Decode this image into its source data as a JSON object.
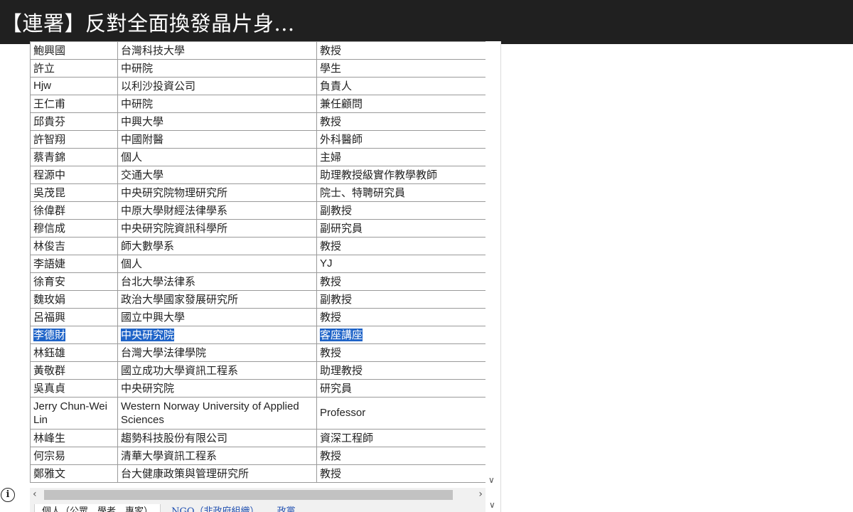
{
  "header": {
    "title": "【連署】反對全面換發晶片身..."
  },
  "table": {
    "rows": [
      {
        "name": "鮑興國",
        "org": "台灣科技大學",
        "title": "教授"
      },
      {
        "name": "許立",
        "org": "中研院",
        "title": "學生"
      },
      {
        "name": "Hjw",
        "org": "以利沙投資公司",
        "title": "負責人"
      },
      {
        "name": "王仁甫",
        "org": "中研院",
        "title": "兼任顧問"
      },
      {
        "name": "邱貴芬",
        "org": "中興大學",
        "title": "教授"
      },
      {
        "name": "許智翔",
        "org": "中國附醫",
        "title": "外科醫師"
      },
      {
        "name": "蔡青錦",
        "org": "個人",
        "title": "主婦"
      },
      {
        "name": "程源中",
        "org": "交通大學",
        "title": "助理教授級實作教學教師"
      },
      {
        "name": "吳茂昆",
        "org": "中央研究院物理研究所",
        "title": "院士、特聘研究員"
      },
      {
        "name": "徐偉群",
        "org": "中原大學財經法律學系",
        "title": "副教授"
      },
      {
        "name": "穆信成",
        "org": "中央研究院資訊科學所",
        "title": "副研究員"
      },
      {
        "name": "林俊吉",
        "org": "師大數學系",
        "title": "教授"
      },
      {
        "name": "李語婕",
        "org": "個人",
        "title": "YJ"
      },
      {
        "name": "徐育安",
        "org": "台北大學法律系",
        "title": "教授"
      },
      {
        "name": "魏玫娟",
        "org": "政治大學國家發展研究所",
        "title": "副教授"
      },
      {
        "name": "呂福興",
        "org": "國立中興大學",
        "title": "教授"
      },
      {
        "name": "李德財",
        "org": "中央研究院",
        "title": "客座講座"
      },
      {
        "name": "林鈺雄",
        "org": "台灣大學法律學院",
        "title": "教授"
      },
      {
        "name": "黃敬群",
        "org": "國立成功大學資訊工程系",
        "title": "助理教授"
      },
      {
        "name": "吳真貞",
        "org": "中央研究院",
        "title": "研究員"
      },
      {
        "name": "Jerry Chun-Wei Lin",
        "org": "Western Norway University of Applied Sciences",
        "title": "Professor"
      },
      {
        "name": "林峰生",
        "org": "趨勢科技股份有限公司",
        "title": "資深工程師"
      },
      {
        "name": "何宗易",
        "org": "清華大學資訊工程系",
        "title": "教授"
      },
      {
        "name": "鄭雅文",
        "org": "台大健康政策與管理研究所",
        "title": "教授"
      }
    ]
  },
  "selected_row_index": 16,
  "tabs": [
    {
      "label": "個人（公眾、學者、專家）",
      "active": true
    },
    {
      "label": "NGO（非政府組織）",
      "active": false
    },
    {
      "label": "政黨",
      "active": false
    }
  ],
  "icons": {
    "info": "info-icon",
    "scroll_down": "chevron-down-icon",
    "scroll_left": "chevron-left-icon",
    "scroll_right": "chevron-right-icon"
  },
  "colors": {
    "titlebar_bg": "#202020",
    "selection": "#1f64c8",
    "tab_link": "#2150b0"
  }
}
